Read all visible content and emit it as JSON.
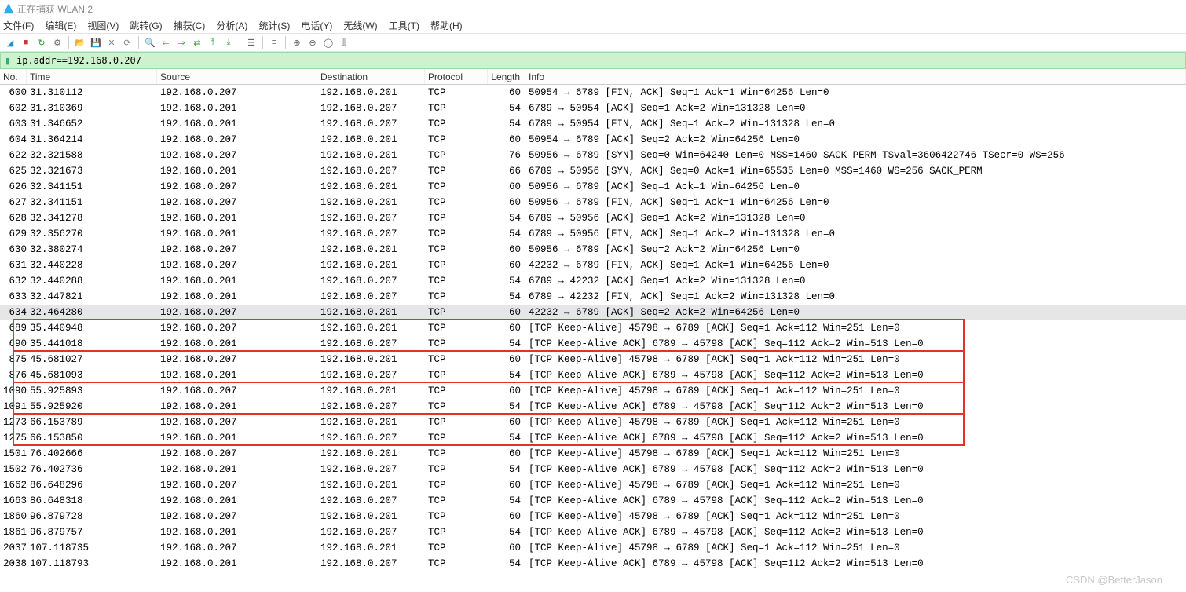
{
  "title": "正在捕获 WLAN 2",
  "menus": [
    "文件(F)",
    "编辑(E)",
    "视图(V)",
    "跳转(G)",
    "捕获(C)",
    "分析(A)",
    "统计(S)",
    "电话(Y)",
    "无线(W)",
    "工具(T)",
    "帮助(H)"
  ],
  "filter": {
    "value": "ip.addr==192.168.0.207"
  },
  "columns": {
    "no": "No.",
    "time": "Time",
    "src": "Source",
    "dst": "Destination",
    "prot": "Protocol",
    "len": "Length",
    "info": "Info"
  },
  "packets": [
    {
      "no": "600",
      "time": "31.310112",
      "src": "192.168.0.207",
      "dst": "192.168.0.201",
      "prot": "TCP",
      "len": "60",
      "info": "50954 → 6789 [FIN, ACK] Seq=1 Ack=1 Win=64256 Len=0"
    },
    {
      "no": "602",
      "time": "31.310369",
      "src": "192.168.0.201",
      "dst": "192.168.0.207",
      "prot": "TCP",
      "len": "54",
      "info": "6789 → 50954 [ACK] Seq=1 Ack=2 Win=131328 Len=0"
    },
    {
      "no": "603",
      "time": "31.346652",
      "src": "192.168.0.201",
      "dst": "192.168.0.207",
      "prot": "TCP",
      "len": "54",
      "info": "6789 → 50954 [FIN, ACK] Seq=1 Ack=2 Win=131328 Len=0"
    },
    {
      "no": "604",
      "time": "31.364214",
      "src": "192.168.0.207",
      "dst": "192.168.0.201",
      "prot": "TCP",
      "len": "60",
      "info": "50954 → 6789 [ACK] Seq=2 Ack=2 Win=64256 Len=0"
    },
    {
      "no": "622",
      "time": "32.321588",
      "src": "192.168.0.207",
      "dst": "192.168.0.201",
      "prot": "TCP",
      "len": "76",
      "info": "50956 → 6789 [SYN] Seq=0 Win=64240 Len=0 MSS=1460 SACK_PERM TSval=3606422746 TSecr=0 WS=256"
    },
    {
      "no": "625",
      "time": "32.321673",
      "src": "192.168.0.201",
      "dst": "192.168.0.207",
      "prot": "TCP",
      "len": "66",
      "info": "6789 → 50956 [SYN, ACK] Seq=0 Ack=1 Win=65535 Len=0 MSS=1460 WS=256 SACK_PERM"
    },
    {
      "no": "626",
      "time": "32.341151",
      "src": "192.168.0.207",
      "dst": "192.168.0.201",
      "prot": "TCP",
      "len": "60",
      "info": "50956 → 6789 [ACK] Seq=1 Ack=1 Win=64256 Len=0"
    },
    {
      "no": "627",
      "time": "32.341151",
      "src": "192.168.0.207",
      "dst": "192.168.0.201",
      "prot": "TCP",
      "len": "60",
      "info": "50956 → 6789 [FIN, ACK] Seq=1 Ack=1 Win=64256 Len=0"
    },
    {
      "no": "628",
      "time": "32.341278",
      "src": "192.168.0.201",
      "dst": "192.168.0.207",
      "prot": "TCP",
      "len": "54",
      "info": "6789 → 50956 [ACK] Seq=1 Ack=2 Win=131328 Len=0"
    },
    {
      "no": "629",
      "time": "32.356270",
      "src": "192.168.0.201",
      "dst": "192.168.0.207",
      "prot": "TCP",
      "len": "54",
      "info": "6789 → 50956 [FIN, ACK] Seq=1 Ack=2 Win=131328 Len=0"
    },
    {
      "no": "630",
      "time": "32.380274",
      "src": "192.168.0.207",
      "dst": "192.168.0.201",
      "prot": "TCP",
      "len": "60",
      "info": "50956 → 6789 [ACK] Seq=2 Ack=2 Win=64256 Len=0"
    },
    {
      "no": "631",
      "time": "32.440228",
      "src": "192.168.0.207",
      "dst": "192.168.0.201",
      "prot": "TCP",
      "len": "60",
      "info": "42232 → 6789 [FIN, ACK] Seq=1 Ack=1 Win=64256 Len=0"
    },
    {
      "no": "632",
      "time": "32.440288",
      "src": "192.168.0.201",
      "dst": "192.168.0.207",
      "prot": "TCP",
      "len": "54",
      "info": "6789 → 42232 [ACK] Seq=1 Ack=2 Win=131328 Len=0"
    },
    {
      "no": "633",
      "time": "32.447821",
      "src": "192.168.0.201",
      "dst": "192.168.0.207",
      "prot": "TCP",
      "len": "54",
      "info": "6789 → 42232 [FIN, ACK] Seq=1 Ack=2 Win=131328 Len=0"
    },
    {
      "no": "634",
      "time": "32.464280",
      "src": "192.168.0.207",
      "dst": "192.168.0.201",
      "prot": "TCP",
      "len": "60",
      "info": "42232 → 6789 [ACK] Seq=2 Ack=2 Win=64256 Len=0",
      "sel": true
    },
    {
      "no": "689",
      "time": "35.440948",
      "src": "192.168.0.207",
      "dst": "192.168.0.201",
      "prot": "TCP",
      "len": "60",
      "info": "[TCP Keep-Alive] 45798 → 6789 [ACK] Seq=1 Ack=112 Win=251 Len=0"
    },
    {
      "no": "690",
      "time": "35.441018",
      "src": "192.168.0.201",
      "dst": "192.168.0.207",
      "prot": "TCP",
      "len": "54",
      "info": "[TCP Keep-Alive ACK] 6789 → 45798 [ACK] Seq=112 Ack=2 Win=513 Len=0"
    },
    {
      "no": "875",
      "time": "45.681027",
      "src": "192.168.0.207",
      "dst": "192.168.0.201",
      "prot": "TCP",
      "len": "60",
      "info": "[TCP Keep-Alive] 45798 → 6789 [ACK] Seq=1 Ack=112 Win=251 Len=0"
    },
    {
      "no": "876",
      "time": "45.681093",
      "src": "192.168.0.201",
      "dst": "192.168.0.207",
      "prot": "TCP",
      "len": "54",
      "info": "[TCP Keep-Alive ACK] 6789 → 45798 [ACK] Seq=112 Ack=2 Win=513 Len=0"
    },
    {
      "no": "1090",
      "time": "55.925893",
      "src": "192.168.0.207",
      "dst": "192.168.0.201",
      "prot": "TCP",
      "len": "60",
      "info": "[TCP Keep-Alive] 45798 → 6789 [ACK] Seq=1 Ack=112 Win=251 Len=0"
    },
    {
      "no": "1091",
      "time": "55.925920",
      "src": "192.168.0.201",
      "dst": "192.168.0.207",
      "prot": "TCP",
      "len": "54",
      "info": "[TCP Keep-Alive ACK] 6789 → 45798 [ACK] Seq=112 Ack=2 Win=513 Len=0"
    },
    {
      "no": "1273",
      "time": "66.153789",
      "src": "192.168.0.207",
      "dst": "192.168.0.201",
      "prot": "TCP",
      "len": "60",
      "info": "[TCP Keep-Alive] 45798 → 6789 [ACK] Seq=1 Ack=112 Win=251 Len=0"
    },
    {
      "no": "1275",
      "time": "66.153850",
      "src": "192.168.0.201",
      "dst": "192.168.0.207",
      "prot": "TCP",
      "len": "54",
      "info": "[TCP Keep-Alive ACK] 6789 → 45798 [ACK] Seq=112 Ack=2 Win=513 Len=0"
    },
    {
      "no": "1501",
      "time": "76.402666",
      "src": "192.168.0.207",
      "dst": "192.168.0.201",
      "prot": "TCP",
      "len": "60",
      "info": "[TCP Keep-Alive] 45798 → 6789 [ACK] Seq=1 Ack=112 Win=251 Len=0"
    },
    {
      "no": "1502",
      "time": "76.402736",
      "src": "192.168.0.201",
      "dst": "192.168.0.207",
      "prot": "TCP",
      "len": "54",
      "info": "[TCP Keep-Alive ACK] 6789 → 45798 [ACK] Seq=112 Ack=2 Win=513 Len=0"
    },
    {
      "no": "1662",
      "time": "86.648296",
      "src": "192.168.0.207",
      "dst": "192.168.0.201",
      "prot": "TCP",
      "len": "60",
      "info": "[TCP Keep-Alive] 45798 → 6789 [ACK] Seq=1 Ack=112 Win=251 Len=0"
    },
    {
      "no": "1663",
      "time": "86.648318",
      "src": "192.168.0.201",
      "dst": "192.168.0.207",
      "prot": "TCP",
      "len": "54",
      "info": "[TCP Keep-Alive ACK] 6789 → 45798 [ACK] Seq=112 Ack=2 Win=513 Len=0"
    },
    {
      "no": "1860",
      "time": "96.879728",
      "src": "192.168.0.207",
      "dst": "192.168.0.201",
      "prot": "TCP",
      "len": "60",
      "info": "[TCP Keep-Alive] 45798 → 6789 [ACK] Seq=1 Ack=112 Win=251 Len=0"
    },
    {
      "no": "1861",
      "time": "96.879757",
      "src": "192.168.0.201",
      "dst": "192.168.0.207",
      "prot": "TCP",
      "len": "54",
      "info": "[TCP Keep-Alive ACK] 6789 → 45798 [ACK] Seq=112 Ack=2 Win=513 Len=0"
    },
    {
      "no": "2037",
      "time": "107.118735",
      "src": "192.168.0.207",
      "dst": "192.168.0.201",
      "prot": "TCP",
      "len": "60",
      "info": "[TCP Keep-Alive] 45798 → 6789 [ACK] Seq=1 Ack=112 Win=251 Len=0"
    },
    {
      "no": "2038",
      "time": "107.118793",
      "src": "192.168.0.201",
      "dst": "192.168.0.207",
      "prot": "TCP",
      "len": "54",
      "info": "[TCP Keep-Alive ACK] 6789 → 45798 [ACK] Seq=112 Ack=2 Win=513 Len=0"
    }
  ],
  "boxes": [
    {
      "startRow": 15,
      "rows": 2
    },
    {
      "startRow": 17,
      "rows": 2
    },
    {
      "startRow": 19,
      "rows": 2
    },
    {
      "startRow": 21,
      "rows": 2
    }
  ],
  "watermark": "CSDN @BetterJason"
}
